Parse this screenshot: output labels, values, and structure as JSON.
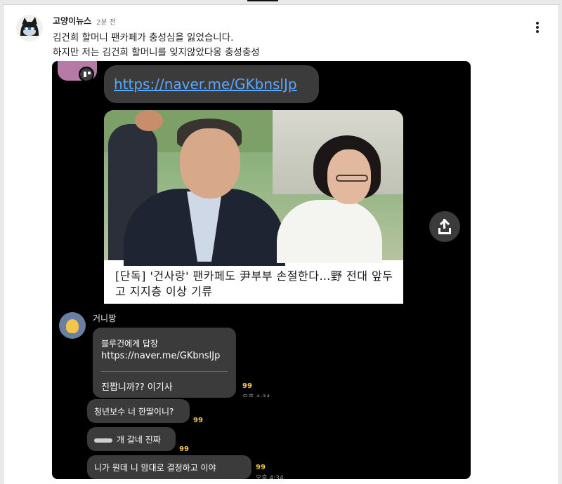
{
  "post": {
    "author": "고양이뉴스",
    "time": "2분 전",
    "line1": "김건희 할머니 팬카페가 충성심을 잃었습니다.",
    "line2": "하지만 저는 김건희 할머니를 잊지않았다옹 충성충성"
  },
  "screenshot": {
    "link": "https://naver.me/GKbnslJp",
    "article_headline": "[단독] '건사랑' 팬카페도 尹부부 손절한다…野 전대 앞두고 지지층 이상 기류",
    "sender2_name": "거니짱",
    "reply": {
      "title": "블루건에게 답장",
      "quote": "https://naver.me/GKbnslJp",
      "message": "진짭니까?? 이기사"
    },
    "messages": [
      {
        "text": "청년보수 너 한딸이니?"
      },
      {
        "text": "개 갈네 진짜"
      },
      {
        "text": "니가 뭔데 니 맘대로 결정하고 이야"
      }
    ],
    "read_count": "99",
    "timestamps": [
      "오후 4:34",
      "오후 4:34"
    ]
  },
  "icons": {
    "more": "vertical-ellipsis-icon",
    "share": "share-icon",
    "badge": "app-badge-icon"
  },
  "colors": {
    "link": "#5aa7ff",
    "read_count": "#f0c44a",
    "bubble": "#3b3b3b"
  }
}
